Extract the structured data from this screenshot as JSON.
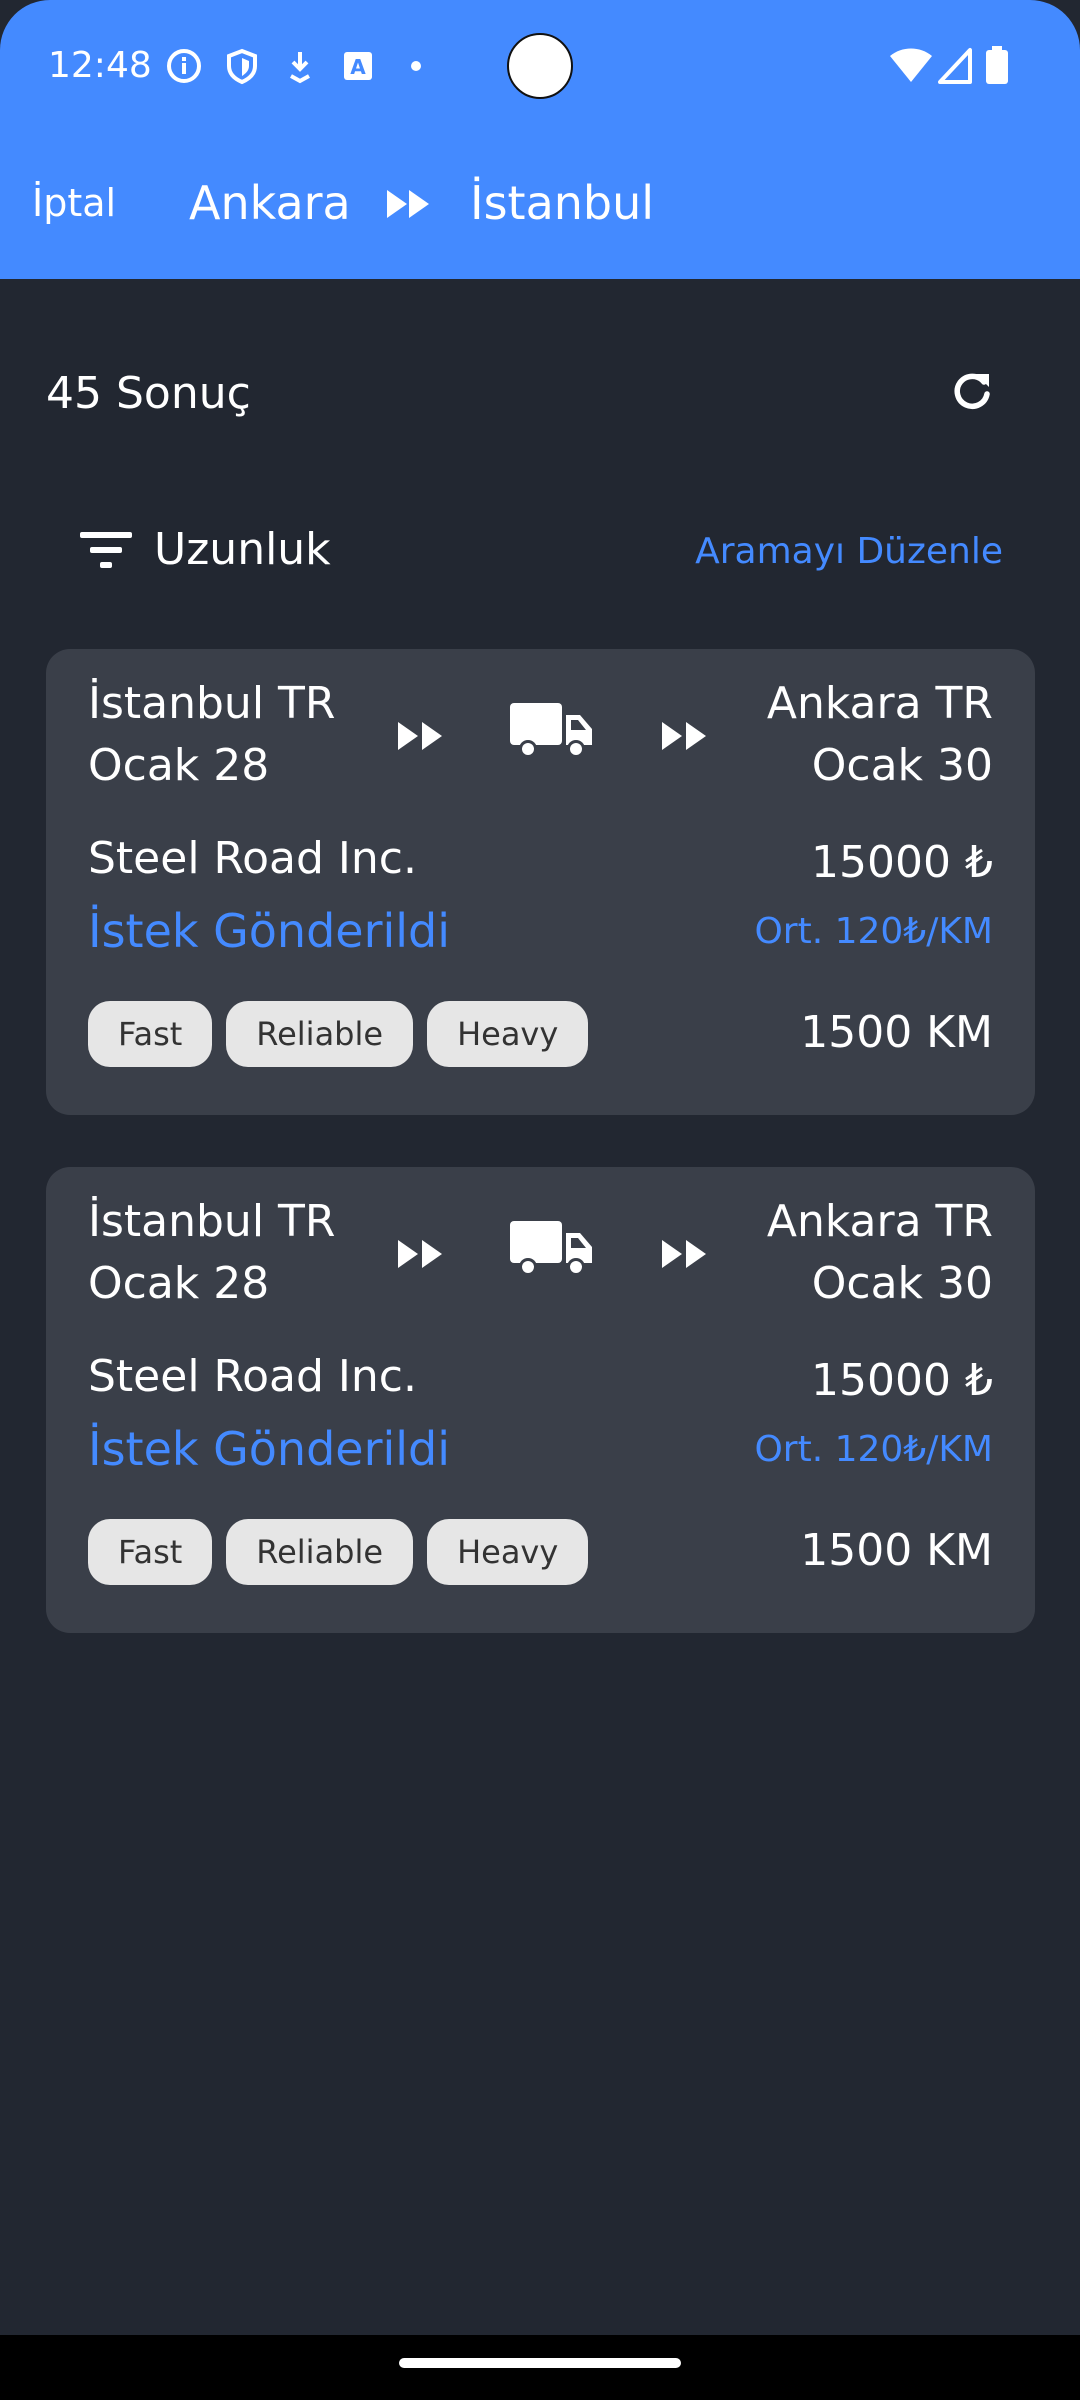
{
  "status_bar": {
    "time": "12:48",
    "icons": [
      "info-icon",
      "shield-icon",
      "download-icon",
      "translate-icon",
      "dot-icon",
      "wifi-icon",
      "signal-icon",
      "battery-icon"
    ]
  },
  "header": {
    "cancel_label": "İptal",
    "route_from": "Ankara",
    "route_to": "İstanbul",
    "background_color": "#448aff"
  },
  "results": {
    "count_label": "45 Sonuç",
    "sort_label": "Uzunluk",
    "edit_search_label": "Aramayı Düzenle"
  },
  "loads": [
    {
      "origin": "İstanbul TR",
      "origin_date": "Ocak 28",
      "destination": "Ankara TR",
      "destination_date": "Ocak 30",
      "company": "Steel Road Inc.",
      "price": "15000 ₺",
      "status": "İstek Gönderildi",
      "avg_price": "Ort. 120₺/KM",
      "tags": [
        "Fast",
        "Reliable",
        "Heavy"
      ],
      "distance": "1500 KM"
    },
    {
      "origin": "İstanbul TR",
      "origin_date": "Ocak 28",
      "destination": "Ankara TR",
      "destination_date": "Ocak 30",
      "company": "Steel Road Inc.",
      "price": "15000 ₺",
      "status": "İstek Gönderildi",
      "avg_price": "Ort. 120₺/KM",
      "tags": [
        "Fast",
        "Reliable",
        "Heavy"
      ],
      "distance": "1500 KM"
    }
  ],
  "colors": {
    "accent": "#448aff",
    "background": "#222731",
    "card": "#3a3f49",
    "chip": "#e6e6e6"
  }
}
